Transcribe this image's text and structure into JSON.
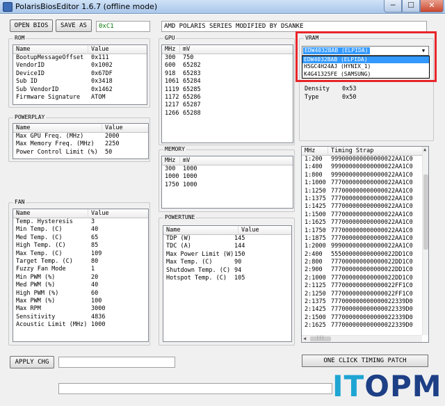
{
  "window": {
    "title": "PolarisBiosEditor 1.6.7 (offline mode)",
    "minimize": "─",
    "maximize": "☐",
    "close": "✕"
  },
  "toolbar": {
    "open_bios": "OPEN BIOS",
    "save_as": "SAVE AS",
    "checksum": "0xC1",
    "bios_name": "AMD POLARIS SERIES MODIFIED BY DSANKE"
  },
  "rom": {
    "legend": "ROM",
    "col_name": "Name",
    "col_value": "Value",
    "rows": [
      [
        "BootupMessageOffset",
        "0x111"
      ],
      [
        "VendorID",
        "0x1002"
      ],
      [
        "DeviceID",
        "0x67DF"
      ],
      [
        "Sub ID",
        "0x3418"
      ],
      [
        "Sub VendorID",
        "0x1462"
      ],
      [
        "Firmware Signature",
        "ATOM"
      ]
    ]
  },
  "powerplay": {
    "legend": "POWERPLAY",
    "col_name": "Name",
    "col_value": "Value",
    "rows": [
      [
        "Max GPU Freq. (MHz)",
        "2000"
      ],
      [
        "Max Memory Freq. (MHz)",
        "2250"
      ],
      [
        "Power Control Limit (%)",
        "50"
      ]
    ]
  },
  "fan": {
    "legend": "FAN",
    "col_name": "Name",
    "col_value": "Value",
    "rows": [
      [
        "Temp. Hysteresis",
        "3"
      ],
      [
        "Min Temp. (C)",
        "40"
      ],
      [
        "Med Temp. (C)",
        "65"
      ],
      [
        "High Temp. (C)",
        "85"
      ],
      [
        "Max Temp. (C)",
        "109"
      ],
      [
        "Target Temp. (C)",
        "80"
      ],
      [
        "Fuzzy Fan Mode",
        "1"
      ],
      [
        "Min PWM (%)",
        "20"
      ],
      [
        "Med PWM (%)",
        "40"
      ],
      [
        "High PWM (%)",
        "60"
      ],
      [
        "Max PWM (%)",
        "100"
      ],
      [
        "Max RPM",
        "3000"
      ],
      [
        "Sensitivity",
        "4836"
      ],
      [
        "Acoustic Limit (MHz)",
        "1000"
      ]
    ]
  },
  "gpu": {
    "legend": "GPU",
    "col_mhz": "MHz",
    "col_mv": "mV",
    "rows": [
      [
        "300",
        "750"
      ],
      [
        "600",
        "65282"
      ],
      [
        "918",
        "65283"
      ],
      [
        "1061",
        "65284"
      ],
      [
        "1119",
        "65285"
      ],
      [
        "1172",
        "65286"
      ],
      [
        "1217",
        "65287"
      ],
      [
        "1266",
        "65288"
      ]
    ]
  },
  "memory": {
    "legend": "MEMORY",
    "col_mhz": "MHz",
    "col_mv": "mV",
    "rows": [
      [
        "300",
        "1000"
      ],
      [
        "1000",
        "1000"
      ],
      [
        "1750",
        "1000"
      ]
    ]
  },
  "powertune": {
    "legend": "POWERTUNE",
    "col_name": "Name",
    "col_value": "Value",
    "rows": [
      [
        "TDP (W)",
        "145"
      ],
      [
        "TDC (A)",
        "144"
      ],
      [
        "Max Power Limit (W)",
        "150"
      ],
      [
        "Max Temp. (C)",
        "90"
      ],
      [
        "Shutdown Temp. (C)",
        "94"
      ],
      [
        "Hotspot Temp. (C)",
        "105"
      ]
    ]
  },
  "vram": {
    "legend": "VRAM",
    "selected": "EDW4032BAB (ELPIDA)",
    "options": [
      "EDW4032BAB (ELPIDA)",
      "H5GC4H24AJ (HYNIX_1)",
      "K4G41325FE (SAMSUNG)"
    ],
    "density_label": "Density",
    "density_value": "0x53",
    "type_label": "Type",
    "type_value": "0x50"
  },
  "timing": {
    "col_mhz": "MHz",
    "col_strap": "Timing Strap",
    "rows": [
      [
        "1:200",
        "999000000000000022AA1C0"
      ],
      [
        "1:400",
        "999000000000000022AA1C0"
      ],
      [
        "1:800",
        "999000000000000022AA1C0"
      ],
      [
        "1:1000",
        "777000000000000022AA1C0"
      ],
      [
        "1:1250",
        "777000000000000022AA1C0"
      ],
      [
        "1:1375",
        "777000000000000022AA1C0"
      ],
      [
        "1:1425",
        "777000000000000022AA1C0"
      ],
      [
        "1:1500",
        "777000000000000022AA1C0"
      ],
      [
        "1:1625",
        "777000000000000022AA1C0"
      ],
      [
        "1:1750",
        "777000000000000022AA1C0"
      ],
      [
        "1:1875",
        "777000000000000022AA1C0"
      ],
      [
        "1:2000",
        "999000000000000022AA1C0"
      ],
      [
        "2:400",
        "555000000000000022DD1C0"
      ],
      [
        "2:800",
        "777000000000000022DD1C0"
      ],
      [
        "2:900",
        "777000000000000022DD1C0"
      ],
      [
        "2:1000",
        "777000000000000022DD1C0"
      ],
      [
        "2:1125",
        "777000000000000022FF1C0"
      ],
      [
        "2:1250",
        "777000000000000022FF1C0"
      ],
      [
        "2:1375",
        "777000000000000022339D0"
      ],
      [
        "2:1425",
        "777000000000000022339D0"
      ],
      [
        "2:1500",
        "777000000000000022339D0"
      ],
      [
        "2:1625",
        "777000000000000022339D0"
      ]
    ]
  },
  "bottom": {
    "apply_chg": "APPLY CHG",
    "one_click": "ONE CLICK TIMING PATCH"
  },
  "watermark": {
    "part1": "IT",
    "part2": "OPM"
  }
}
